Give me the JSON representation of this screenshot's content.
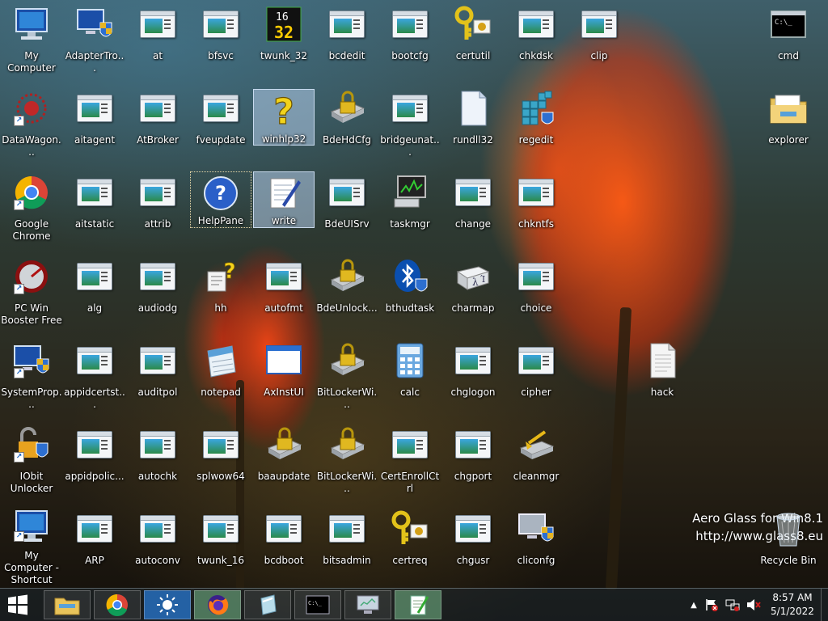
{
  "desktop_icons": [
    {
      "label": "My Computer",
      "icon": "computer-icon"
    },
    {
      "label": "AdapterTro...",
      "icon": "shield-monitor-icon"
    },
    {
      "label": "at",
      "icon": "exe-window-icon"
    },
    {
      "label": "bfsvc",
      "icon": "exe-window-icon"
    },
    {
      "label": "twunk_32",
      "icon": "twain-icon"
    },
    {
      "label": "bcdedit",
      "icon": "exe-window-icon"
    },
    {
      "label": "bootcfg",
      "icon": "exe-window-icon"
    },
    {
      "label": "certutil",
      "icon": "key-cert-icon"
    },
    {
      "label": "chkdsk",
      "icon": "exe-window-icon"
    },
    {
      "label": "clip",
      "icon": "exe-window-icon"
    },
    {
      "label": "cmd",
      "icon": "console-icon"
    },
    {
      "label": "DataWagon...",
      "icon": "datawagon-icon"
    },
    {
      "label": "aitagent",
      "icon": "exe-window-icon"
    },
    {
      "label": "AtBroker",
      "icon": "exe-window-icon"
    },
    {
      "label": "fveupdate",
      "icon": "exe-window-icon"
    },
    {
      "label": "winhlp32",
      "icon": "help-question-icon"
    },
    {
      "label": "BdeHdCfg",
      "icon": "bitlocker-drive-icon"
    },
    {
      "label": "bridgeunat...",
      "icon": "exe-window-icon"
    },
    {
      "label": "rundll32",
      "icon": "blank-file-icon"
    },
    {
      "label": "regedit",
      "icon": "regedit-icon"
    },
    {
      "label": "explorer",
      "icon": "folder-icon"
    },
    {
      "label": "Google Chrome",
      "icon": "chrome-icon"
    },
    {
      "label": "aitstatic",
      "icon": "exe-window-icon"
    },
    {
      "label": "attrib",
      "icon": "exe-window-icon"
    },
    {
      "label": "HelpPane",
      "icon": "help-circle-icon"
    },
    {
      "label": "write",
      "icon": "write-notepad-icon"
    },
    {
      "label": "BdeUISrv",
      "icon": "exe-window-icon"
    },
    {
      "label": "taskmgr",
      "icon": "task-manager-icon"
    },
    {
      "label": "change",
      "icon": "exe-window-icon"
    },
    {
      "label": "chkntfs",
      "icon": "exe-window-icon"
    },
    {
      "label": "PC Win Booster Free",
      "icon": "booster-gauge-icon"
    },
    {
      "label": "alg",
      "icon": "exe-window-icon"
    },
    {
      "label": "audiodg",
      "icon": "exe-window-icon"
    },
    {
      "label": "hh",
      "icon": "help-doc-icon"
    },
    {
      "label": "autofmt",
      "icon": "exe-window-icon"
    },
    {
      "label": "BdeUnlock...",
      "icon": "bitlocker-drive-icon"
    },
    {
      "label": "bthudtask",
      "icon": "bluetooth-icon"
    },
    {
      "label": "charmap",
      "icon": "charmap-icon"
    },
    {
      "label": "choice",
      "icon": "exe-window-icon"
    },
    {
      "label": "SystemProp...",
      "icon": "shield-monitor-icon"
    },
    {
      "label": "appidcertst...",
      "icon": "exe-window-icon"
    },
    {
      "label": "auditpol",
      "icon": "exe-window-icon"
    },
    {
      "label": "notepad",
      "icon": "notepad-icon"
    },
    {
      "label": "AxInstUI",
      "icon": "blank-window-icon"
    },
    {
      "label": "BitLockerWi...",
      "icon": "bitlocker-drive-icon"
    },
    {
      "label": "calc",
      "icon": "calculator-icon"
    },
    {
      "label": "chglogon",
      "icon": "exe-window-icon"
    },
    {
      "label": "cipher",
      "icon": "exe-window-icon"
    },
    {
      "label": "hack",
      "icon": "blank-file-icon"
    },
    {
      "label": "IObit Unlocker",
      "icon": "unlocker-icon"
    },
    {
      "label": "appidpolic...",
      "icon": "exe-window-icon"
    },
    {
      "label": "autochk",
      "icon": "exe-window-icon"
    },
    {
      "label": "splwow64",
      "icon": "exe-window-icon"
    },
    {
      "label": "baaupdate",
      "icon": "bitlocker-drive-icon"
    },
    {
      "label": "BitLockerWi...",
      "icon": "bitlocker-drive-icon"
    },
    {
      "label": "CertEnrollCtrl",
      "icon": "exe-window-icon"
    },
    {
      "label": "chgport",
      "icon": "exe-window-icon"
    },
    {
      "label": "cleanmgr",
      "icon": "disk-cleanup-icon"
    },
    {
      "label": "My Computer - Shortcut",
      "icon": "computer-icon"
    },
    {
      "label": "ARP",
      "icon": "exe-window-icon"
    },
    {
      "label": "autoconv",
      "icon": "exe-window-icon"
    },
    {
      "label": "twunk_16",
      "icon": "exe-window-icon"
    },
    {
      "label": "bcdboot",
      "icon": "exe-window-icon"
    },
    {
      "label": "bitsadmin",
      "icon": "exe-window-icon"
    },
    {
      "label": "certreq",
      "icon": "key-cert-icon"
    },
    {
      "label": "chgusr",
      "icon": "exe-window-icon"
    },
    {
      "label": "cliconfg",
      "icon": "shield-monitor-icon"
    },
    {
      "label": "Recycle Bin",
      "icon": "recycle-bin-icon"
    }
  ],
  "watermark": {
    "line1": "Aero Glass for Win8.1",
    "line2": "http://www.glass8.eu"
  },
  "taskbar": {
    "start_icon": "windows-logo-icon",
    "pinned": [
      {
        "name": "file-explorer",
        "icon": "folder-icon"
      },
      {
        "name": "chrome",
        "icon": "chrome-icon"
      },
      {
        "name": "weather",
        "icon": "sun-icon"
      },
      {
        "name": "firefox",
        "icon": "firefox-icon"
      },
      {
        "name": "glass",
        "icon": "glass-icon"
      },
      {
        "name": "cmd",
        "icon": "console-icon"
      },
      {
        "name": "system",
        "icon": "monitor-icon"
      },
      {
        "name": "notepad-plus",
        "icon": "notepad-plus-icon"
      }
    ],
    "time": "8:57 AM",
    "date": "5/1/2022"
  }
}
